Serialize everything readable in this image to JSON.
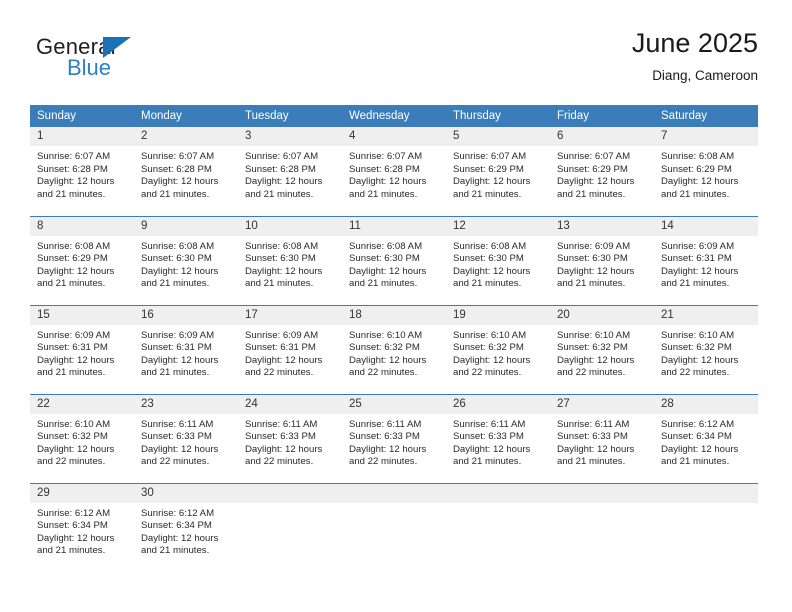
{
  "brand": {
    "name_top": "General",
    "name_bottom": "Blue",
    "triangle_color": "#1b71b8",
    "blue_text_color": "#2b80c6"
  },
  "header": {
    "title": "June 2025",
    "subtitle": "Diang, Cameroon"
  },
  "theme": {
    "header_blue": "#3a7dba",
    "daynum_gray": "#efefef",
    "text_color": "#2a2a2a"
  },
  "weekday_headers": [
    "Sunday",
    "Monday",
    "Tuesday",
    "Wednesday",
    "Thursday",
    "Friday",
    "Saturday"
  ],
  "labels": {
    "sunrise": "Sunrise:",
    "sunset": "Sunset:",
    "daylight": "Daylight:"
  },
  "weeks": [
    [
      {
        "day": "1",
        "sunrise": "Sunrise: 6:07 AM",
        "sunset": "Sunset: 6:28 PM",
        "daylight": "Daylight: 12 hours and 21 minutes."
      },
      {
        "day": "2",
        "sunrise": "Sunrise: 6:07 AM",
        "sunset": "Sunset: 6:28 PM",
        "daylight": "Daylight: 12 hours and 21 minutes."
      },
      {
        "day": "3",
        "sunrise": "Sunrise: 6:07 AM",
        "sunset": "Sunset: 6:28 PM",
        "daylight": "Daylight: 12 hours and 21 minutes."
      },
      {
        "day": "4",
        "sunrise": "Sunrise: 6:07 AM",
        "sunset": "Sunset: 6:28 PM",
        "daylight": "Daylight: 12 hours and 21 minutes."
      },
      {
        "day": "5",
        "sunrise": "Sunrise: 6:07 AM",
        "sunset": "Sunset: 6:29 PM",
        "daylight": "Daylight: 12 hours and 21 minutes."
      },
      {
        "day": "6",
        "sunrise": "Sunrise: 6:07 AM",
        "sunset": "Sunset: 6:29 PM",
        "daylight": "Daylight: 12 hours and 21 minutes."
      },
      {
        "day": "7",
        "sunrise": "Sunrise: 6:08 AM",
        "sunset": "Sunset: 6:29 PM",
        "daylight": "Daylight: 12 hours and 21 minutes."
      }
    ],
    [
      {
        "day": "8",
        "sunrise": "Sunrise: 6:08 AM",
        "sunset": "Sunset: 6:29 PM",
        "daylight": "Daylight: 12 hours and 21 minutes."
      },
      {
        "day": "9",
        "sunrise": "Sunrise: 6:08 AM",
        "sunset": "Sunset: 6:30 PM",
        "daylight": "Daylight: 12 hours and 21 minutes."
      },
      {
        "day": "10",
        "sunrise": "Sunrise: 6:08 AM",
        "sunset": "Sunset: 6:30 PM",
        "daylight": "Daylight: 12 hours and 21 minutes."
      },
      {
        "day": "11",
        "sunrise": "Sunrise: 6:08 AM",
        "sunset": "Sunset: 6:30 PM",
        "daylight": "Daylight: 12 hours and 21 minutes."
      },
      {
        "day": "12",
        "sunrise": "Sunrise: 6:08 AM",
        "sunset": "Sunset: 6:30 PM",
        "daylight": "Daylight: 12 hours and 21 minutes."
      },
      {
        "day": "13",
        "sunrise": "Sunrise: 6:09 AM",
        "sunset": "Sunset: 6:30 PM",
        "daylight": "Daylight: 12 hours and 21 minutes."
      },
      {
        "day": "14",
        "sunrise": "Sunrise: 6:09 AM",
        "sunset": "Sunset: 6:31 PM",
        "daylight": "Daylight: 12 hours and 21 minutes."
      }
    ],
    [
      {
        "day": "15",
        "sunrise": "Sunrise: 6:09 AM",
        "sunset": "Sunset: 6:31 PM",
        "daylight": "Daylight: 12 hours and 21 minutes."
      },
      {
        "day": "16",
        "sunrise": "Sunrise: 6:09 AM",
        "sunset": "Sunset: 6:31 PM",
        "daylight": "Daylight: 12 hours and 21 minutes."
      },
      {
        "day": "17",
        "sunrise": "Sunrise: 6:09 AM",
        "sunset": "Sunset: 6:31 PM",
        "daylight": "Daylight: 12 hours and 22 minutes."
      },
      {
        "day": "18",
        "sunrise": "Sunrise: 6:10 AM",
        "sunset": "Sunset: 6:32 PM",
        "daylight": "Daylight: 12 hours and 22 minutes."
      },
      {
        "day": "19",
        "sunrise": "Sunrise: 6:10 AM",
        "sunset": "Sunset: 6:32 PM",
        "daylight": "Daylight: 12 hours and 22 minutes."
      },
      {
        "day": "20",
        "sunrise": "Sunrise: 6:10 AM",
        "sunset": "Sunset: 6:32 PM",
        "daylight": "Daylight: 12 hours and 22 minutes."
      },
      {
        "day": "21",
        "sunrise": "Sunrise: 6:10 AM",
        "sunset": "Sunset: 6:32 PM",
        "daylight": "Daylight: 12 hours and 22 minutes."
      }
    ],
    [
      {
        "day": "22",
        "sunrise": "Sunrise: 6:10 AM",
        "sunset": "Sunset: 6:32 PM",
        "daylight": "Daylight: 12 hours and 22 minutes."
      },
      {
        "day": "23",
        "sunrise": "Sunrise: 6:11 AM",
        "sunset": "Sunset: 6:33 PM",
        "daylight": "Daylight: 12 hours and 22 minutes."
      },
      {
        "day": "24",
        "sunrise": "Sunrise: 6:11 AM",
        "sunset": "Sunset: 6:33 PM",
        "daylight": "Daylight: 12 hours and 22 minutes."
      },
      {
        "day": "25",
        "sunrise": "Sunrise: 6:11 AM",
        "sunset": "Sunset: 6:33 PM",
        "daylight": "Daylight: 12 hours and 22 minutes."
      },
      {
        "day": "26",
        "sunrise": "Sunrise: 6:11 AM",
        "sunset": "Sunset: 6:33 PM",
        "daylight": "Daylight: 12 hours and 21 minutes."
      },
      {
        "day": "27",
        "sunrise": "Sunrise: 6:11 AM",
        "sunset": "Sunset: 6:33 PM",
        "daylight": "Daylight: 12 hours and 21 minutes."
      },
      {
        "day": "28",
        "sunrise": "Sunrise: 6:12 AM",
        "sunset": "Sunset: 6:34 PM",
        "daylight": "Daylight: 12 hours and 21 minutes."
      }
    ],
    [
      {
        "day": "29",
        "sunrise": "Sunrise: 6:12 AM",
        "sunset": "Sunset: 6:34 PM",
        "daylight": "Daylight: 12 hours and 21 minutes."
      },
      {
        "day": "30",
        "sunrise": "Sunrise: 6:12 AM",
        "sunset": "Sunset: 6:34 PM",
        "daylight": "Daylight: 12 hours and 21 minutes."
      },
      {
        "day": "",
        "sunrise": "",
        "sunset": "",
        "daylight": ""
      },
      {
        "day": "",
        "sunrise": "",
        "sunset": "",
        "daylight": ""
      },
      {
        "day": "",
        "sunrise": "",
        "sunset": "",
        "daylight": ""
      },
      {
        "day": "",
        "sunrise": "",
        "sunset": "",
        "daylight": ""
      },
      {
        "day": "",
        "sunrise": "",
        "sunset": "",
        "daylight": ""
      }
    ]
  ]
}
